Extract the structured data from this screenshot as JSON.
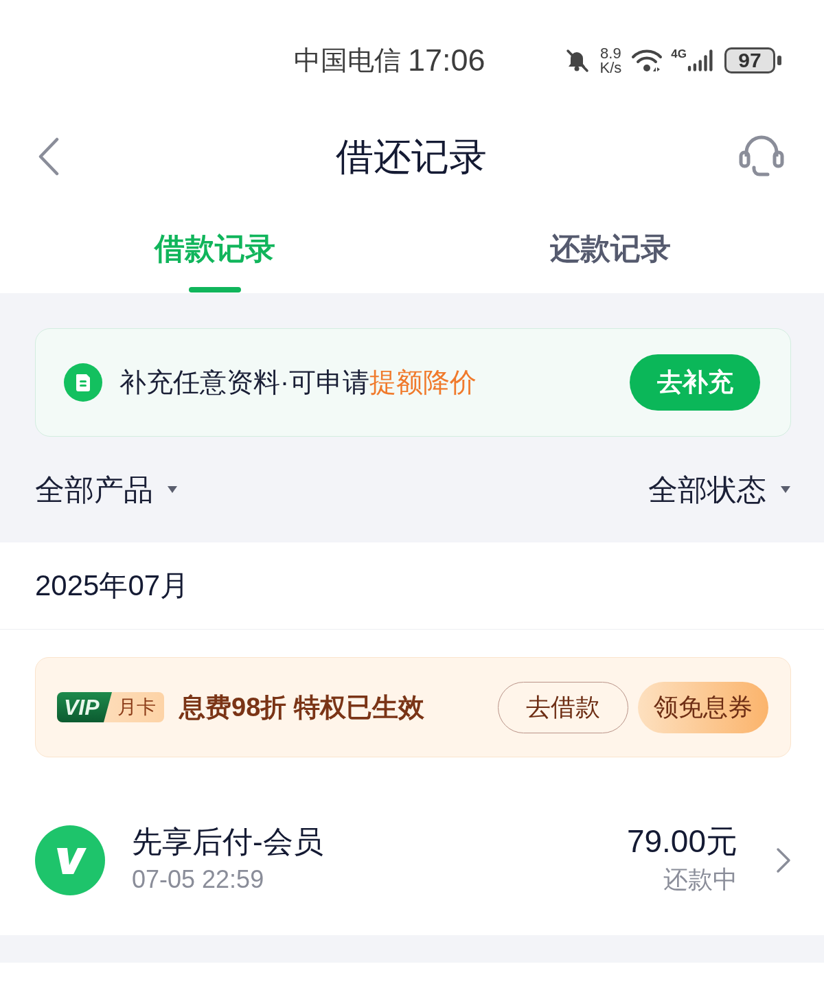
{
  "status_bar": {
    "carrier": "中国电信",
    "time": "17:06",
    "network_speed": {
      "value": "8.9",
      "unit": "K/s"
    },
    "network_type": "4G",
    "battery": "97"
  },
  "header": {
    "title": "借还记录"
  },
  "tabs": [
    {
      "label": "借款记录",
      "selected": true
    },
    {
      "label": "还款记录",
      "selected": false
    }
  ],
  "promo_banner": {
    "text": "补充任意资料·可申请",
    "highlight": "提额降价",
    "button": "去补充"
  },
  "filters": [
    {
      "label": "全部产品"
    },
    {
      "label": "全部状态"
    }
  ],
  "month_header": "2025年07月",
  "vip_banner": {
    "badge": "VIP",
    "badge_label": "月卡",
    "text": "息费98折 特权已生效",
    "buttons": [
      {
        "label": "去借款",
        "kind": "outline"
      },
      {
        "label": "领免息券",
        "kind": "filled"
      }
    ]
  },
  "records": [
    {
      "title": "先享后付-会员",
      "time": "07-05 22:59",
      "amount": "79.00元",
      "status": "还款中"
    }
  ]
}
